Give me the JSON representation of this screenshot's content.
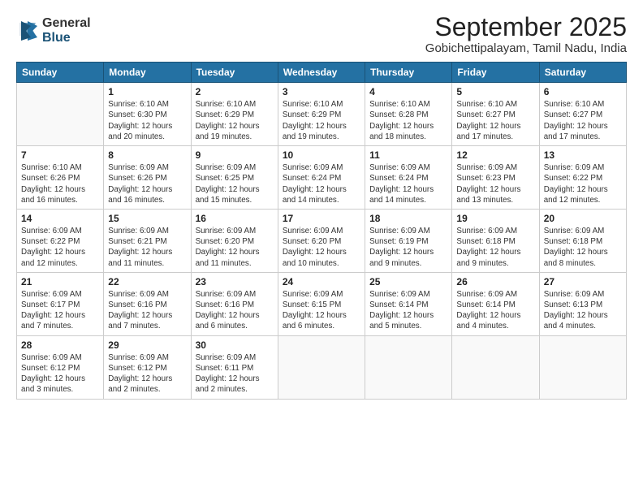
{
  "logo": {
    "general": "General",
    "blue": "Blue"
  },
  "title": "September 2025",
  "subtitle": "Gobichettipalayam, Tamil Nadu, India",
  "header_days": [
    "Sunday",
    "Monday",
    "Tuesday",
    "Wednesday",
    "Thursday",
    "Friday",
    "Saturday"
  ],
  "weeks": [
    [
      {
        "day": "",
        "info": ""
      },
      {
        "day": "1",
        "info": "Sunrise: 6:10 AM\nSunset: 6:30 PM\nDaylight: 12 hours\nand 20 minutes."
      },
      {
        "day": "2",
        "info": "Sunrise: 6:10 AM\nSunset: 6:29 PM\nDaylight: 12 hours\nand 19 minutes."
      },
      {
        "day": "3",
        "info": "Sunrise: 6:10 AM\nSunset: 6:29 PM\nDaylight: 12 hours\nand 19 minutes."
      },
      {
        "day": "4",
        "info": "Sunrise: 6:10 AM\nSunset: 6:28 PM\nDaylight: 12 hours\nand 18 minutes."
      },
      {
        "day": "5",
        "info": "Sunrise: 6:10 AM\nSunset: 6:27 PM\nDaylight: 12 hours\nand 17 minutes."
      },
      {
        "day": "6",
        "info": "Sunrise: 6:10 AM\nSunset: 6:27 PM\nDaylight: 12 hours\nand 17 minutes."
      }
    ],
    [
      {
        "day": "7",
        "info": "Sunrise: 6:10 AM\nSunset: 6:26 PM\nDaylight: 12 hours\nand 16 minutes."
      },
      {
        "day": "8",
        "info": "Sunrise: 6:09 AM\nSunset: 6:26 PM\nDaylight: 12 hours\nand 16 minutes."
      },
      {
        "day": "9",
        "info": "Sunrise: 6:09 AM\nSunset: 6:25 PM\nDaylight: 12 hours\nand 15 minutes."
      },
      {
        "day": "10",
        "info": "Sunrise: 6:09 AM\nSunset: 6:24 PM\nDaylight: 12 hours\nand 14 minutes."
      },
      {
        "day": "11",
        "info": "Sunrise: 6:09 AM\nSunset: 6:24 PM\nDaylight: 12 hours\nand 14 minutes."
      },
      {
        "day": "12",
        "info": "Sunrise: 6:09 AM\nSunset: 6:23 PM\nDaylight: 12 hours\nand 13 minutes."
      },
      {
        "day": "13",
        "info": "Sunrise: 6:09 AM\nSunset: 6:22 PM\nDaylight: 12 hours\nand 12 minutes."
      }
    ],
    [
      {
        "day": "14",
        "info": "Sunrise: 6:09 AM\nSunset: 6:22 PM\nDaylight: 12 hours\nand 12 minutes."
      },
      {
        "day": "15",
        "info": "Sunrise: 6:09 AM\nSunset: 6:21 PM\nDaylight: 12 hours\nand 11 minutes."
      },
      {
        "day": "16",
        "info": "Sunrise: 6:09 AM\nSunset: 6:20 PM\nDaylight: 12 hours\nand 11 minutes."
      },
      {
        "day": "17",
        "info": "Sunrise: 6:09 AM\nSunset: 6:20 PM\nDaylight: 12 hours\nand 10 minutes."
      },
      {
        "day": "18",
        "info": "Sunrise: 6:09 AM\nSunset: 6:19 PM\nDaylight: 12 hours\nand 9 minutes."
      },
      {
        "day": "19",
        "info": "Sunrise: 6:09 AM\nSunset: 6:18 PM\nDaylight: 12 hours\nand 9 minutes."
      },
      {
        "day": "20",
        "info": "Sunrise: 6:09 AM\nSunset: 6:18 PM\nDaylight: 12 hours\nand 8 minutes."
      }
    ],
    [
      {
        "day": "21",
        "info": "Sunrise: 6:09 AM\nSunset: 6:17 PM\nDaylight: 12 hours\nand 7 minutes."
      },
      {
        "day": "22",
        "info": "Sunrise: 6:09 AM\nSunset: 6:16 PM\nDaylight: 12 hours\nand 7 minutes."
      },
      {
        "day": "23",
        "info": "Sunrise: 6:09 AM\nSunset: 6:16 PM\nDaylight: 12 hours\nand 6 minutes."
      },
      {
        "day": "24",
        "info": "Sunrise: 6:09 AM\nSunset: 6:15 PM\nDaylight: 12 hours\nand 6 minutes."
      },
      {
        "day": "25",
        "info": "Sunrise: 6:09 AM\nSunset: 6:14 PM\nDaylight: 12 hours\nand 5 minutes."
      },
      {
        "day": "26",
        "info": "Sunrise: 6:09 AM\nSunset: 6:14 PM\nDaylight: 12 hours\nand 4 minutes."
      },
      {
        "day": "27",
        "info": "Sunrise: 6:09 AM\nSunset: 6:13 PM\nDaylight: 12 hours\nand 4 minutes."
      }
    ],
    [
      {
        "day": "28",
        "info": "Sunrise: 6:09 AM\nSunset: 6:12 PM\nDaylight: 12 hours\nand 3 minutes."
      },
      {
        "day": "29",
        "info": "Sunrise: 6:09 AM\nSunset: 6:12 PM\nDaylight: 12 hours\nand 2 minutes."
      },
      {
        "day": "30",
        "info": "Sunrise: 6:09 AM\nSunset: 6:11 PM\nDaylight: 12 hours\nand 2 minutes."
      },
      {
        "day": "",
        "info": ""
      },
      {
        "day": "",
        "info": ""
      },
      {
        "day": "",
        "info": ""
      },
      {
        "day": "",
        "info": ""
      }
    ]
  ]
}
